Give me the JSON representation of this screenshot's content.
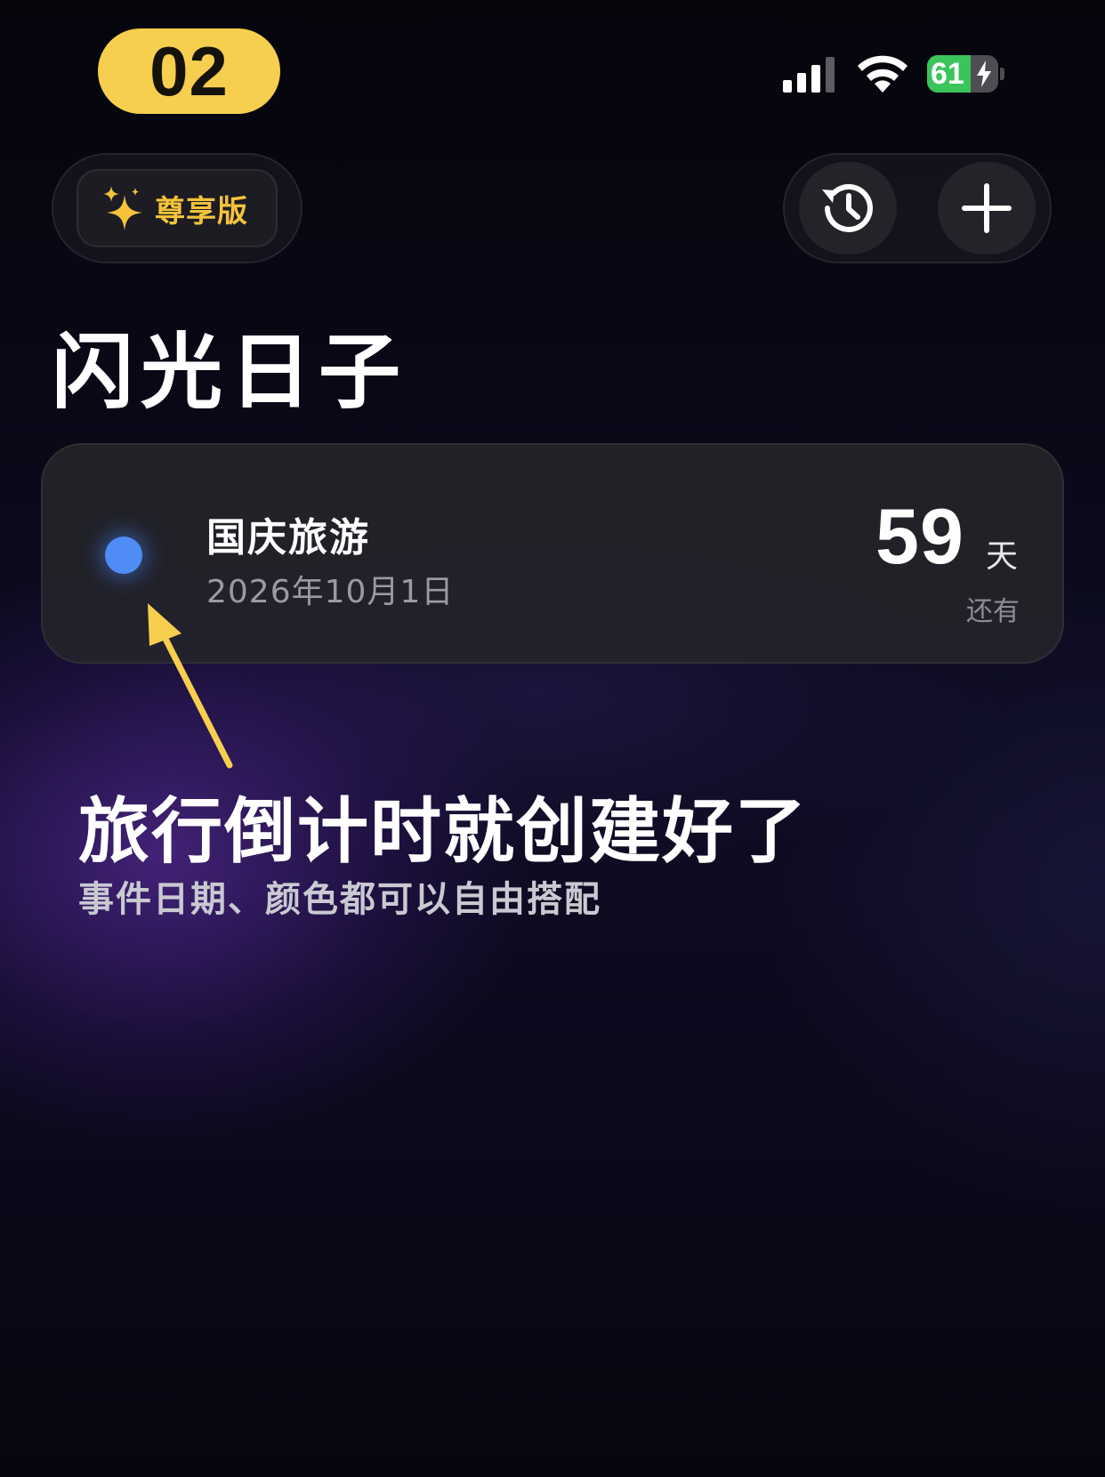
{
  "step_badge": "02",
  "status_bar": {
    "signal_icon": "cellular-signal-icon",
    "wifi_icon": "wifi-icon",
    "battery_percent": "61",
    "battery_level": 0.61,
    "battery_charging": true,
    "battery_color": "#3ac45a"
  },
  "header": {
    "premium_label": "尊享版",
    "premium_icon": "sparkles-icon",
    "history_icon": "history-icon",
    "add_icon": "plus-icon"
  },
  "page_title": "闪光日子",
  "events": [
    {
      "name": "国庆旅游",
      "date": "2026年10月1日",
      "days": "59",
      "unit": "天",
      "status": "还有",
      "color": "#4f8cf5"
    }
  ],
  "annotation": {
    "title": "旅行倒计时就创建好了",
    "subtitle": "事件日期、颜色都可以自由搭配",
    "arrow_color": "#f7cf4e"
  },
  "colors": {
    "accent_yellow": "#f7cf4e",
    "premium_gold": "#f4c33a"
  }
}
